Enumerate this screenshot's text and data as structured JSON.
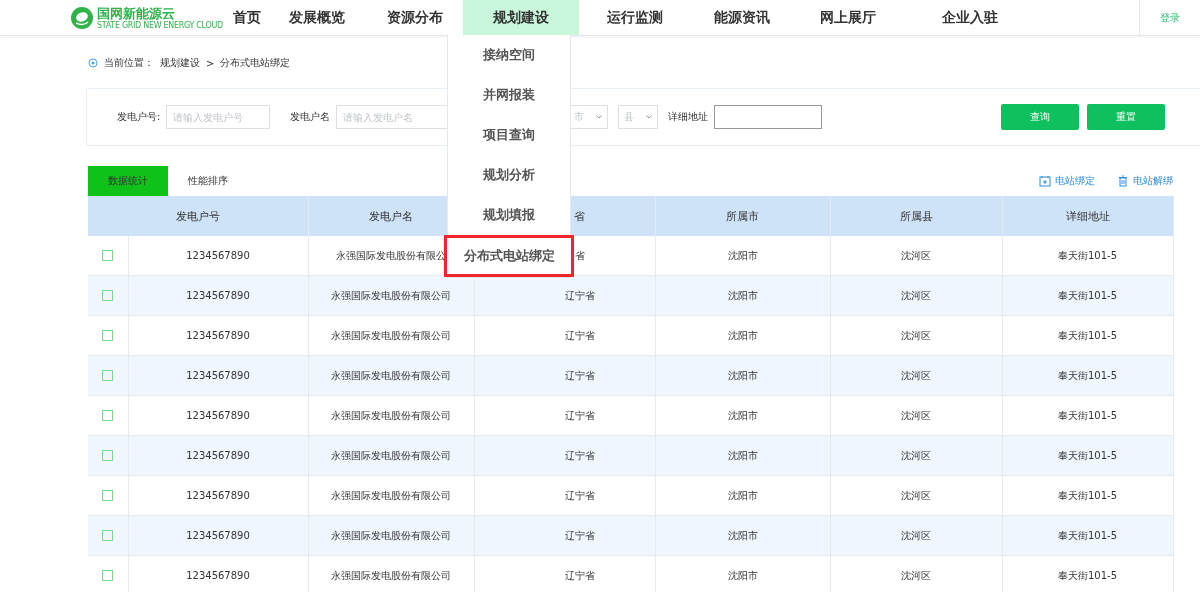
{
  "header": {
    "logo": {
      "title": "国网新能源云",
      "subtitle": "STATE GRID NEW ENERGY CLOUD"
    },
    "nav": [
      {
        "label": "首页",
        "selected": false
      },
      {
        "label": "发展概览",
        "selected": false
      },
      {
        "label": "资源分布",
        "selected": false
      },
      {
        "label": "规划建设",
        "selected": true
      },
      {
        "label": "运行监测",
        "selected": false
      },
      {
        "label": "能源资讯",
        "selected": false
      },
      {
        "label": "网上展厅",
        "selected": false
      },
      {
        "label": "企业入驻",
        "selected": false
      }
    ],
    "login": "登录"
  },
  "dropdown": {
    "items": [
      {
        "label": "接纳空间",
        "selected": false
      },
      {
        "label": "并网报装",
        "selected": false
      },
      {
        "label": "项目查询",
        "selected": false
      },
      {
        "label": "规划分析",
        "selected": false
      },
      {
        "label": "规划填报",
        "selected": false
      },
      {
        "label": "分布式电站绑定",
        "selected": true
      }
    ]
  },
  "breadcrumb": [
    "当前位置：",
    "规划建设",
    ">",
    "分布式电站绑定"
  ],
  "search": {
    "fields": [
      {
        "kind": "input",
        "label": "发电户号:",
        "placeholder": "请输入发电户号"
      },
      {
        "kind": "input",
        "label": "发电户名",
        "placeholder": "请输入发电户名"
      },
      {
        "kind": "select",
        "placeholder": "市"
      },
      {
        "kind": "select",
        "placeholder": "县"
      },
      {
        "kind": "input",
        "label": "详细地址"
      }
    ],
    "buttons": [
      "查询",
      "重置"
    ]
  },
  "tabs": [
    {
      "label": "数据统计",
      "selected": true
    },
    {
      "label": "性能排序",
      "selected": false
    }
  ],
  "actions": [
    {
      "kind": "bind",
      "label": "电站绑定"
    },
    {
      "kind": "unbind",
      "label": "电站解绑"
    }
  ],
  "table": {
    "columns": [
      "发电户号",
      "发电户名",
      "省",
      "所属市",
      "所属县",
      "详细地址"
    ],
    "rows": [
      {
        "checked": false,
        "cells": [
          "1234567890",
          "永强国际发电股份有限公",
          "省",
          "沈阳市",
          "沈河区",
          "奉天街101-5"
        ]
      },
      {
        "checked": false,
        "cells": [
          "1234567890",
          "永强国际发电股份有限公司",
          "辽宁省",
          "沈阳市",
          "沈河区",
          "奉天街101-5"
        ]
      },
      {
        "checked": false,
        "cells": [
          "1234567890",
          "永强国际发电股份有限公司",
          "辽宁省",
          "沈阳市",
          "沈河区",
          "奉天街101-5"
        ]
      },
      {
        "checked": false,
        "cells": [
          "1234567890",
          "永强国际发电股份有限公司",
          "辽宁省",
          "沈阳市",
          "沈河区",
          "奉天街101-5"
        ]
      },
      {
        "checked": false,
        "cells": [
          "1234567890",
          "永强国际发电股份有限公司",
          "辽宁省",
          "沈阳市",
          "沈河区",
          "奉天街101-5"
        ]
      },
      {
        "checked": false,
        "cells": [
          "1234567890",
          "永强国际发电股份有限公司",
          "辽宁省",
          "沈阳市",
          "沈河区",
          "奉天街101-5"
        ]
      },
      {
        "checked": false,
        "cells": [
          "1234567890",
          "永强国际发电股份有限公司",
          "辽宁省",
          "沈阳市",
          "沈河区",
          "奉天街101-5"
        ]
      },
      {
        "checked": false,
        "cells": [
          "1234567890",
          "永强国际发电股份有限公司",
          "辽宁省",
          "沈阳市",
          "沈河区",
          "奉天街101-5"
        ]
      },
      {
        "checked": false,
        "cells": [
          "1234567890",
          "永强国际发电股份有限公司",
          "辽宁省",
          "沈阳市",
          "沈河区",
          "奉天街101-5"
        ]
      }
    ]
  }
}
